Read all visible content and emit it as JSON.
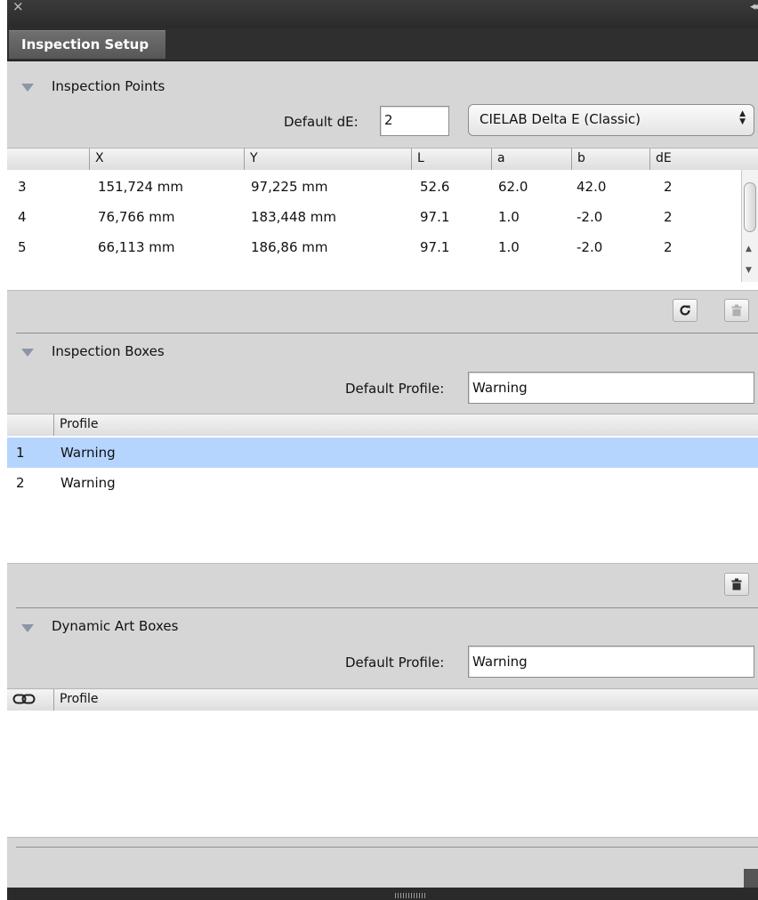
{
  "window": {
    "close_glyph": "×",
    "collapse_glyph": "◂◂",
    "tab_title": "Inspection Setup"
  },
  "points": {
    "title": "Inspection Points",
    "default_de_label": "Default dE:",
    "default_de_value": "2",
    "method_selected": "CIELAB Delta E (Classic)",
    "columns": [
      "",
      "X",
      "Y",
      "L",
      "a",
      "b",
      "dE"
    ],
    "rows": [
      {
        "id": "3",
        "x": "151,724 mm",
        "y": "97,225 mm",
        "L": "52.6",
        "a": "62.0",
        "b": "42.0",
        "dE": "2"
      },
      {
        "id": "4",
        "x": "76,766 mm",
        "y": "183,448 mm",
        "L": "97.1",
        "a": "1.0",
        "b": "-2.0",
        "dE": "2"
      },
      {
        "id": "5",
        "x": "66,113 mm",
        "y": "186,86 mm",
        "L": "97.1",
        "a": "1.0",
        "b": "-2.0",
        "dE": "2"
      }
    ],
    "refresh_icon": "refresh-icon",
    "trash_icon": "trash-icon"
  },
  "boxes": {
    "title": "Inspection Boxes",
    "default_profile_label": "Default Profile:",
    "default_profile_value": "Warning",
    "columns": [
      "",
      "Profile"
    ],
    "rows": [
      {
        "id": "1",
        "profile": "Warning",
        "selected": true
      },
      {
        "id": "2",
        "profile": "Warning",
        "selected": false
      }
    ],
    "selection_color": "#b5d5ff"
  },
  "art_boxes": {
    "title": "Dynamic Art Boxes",
    "default_profile_label": "Default Profile:",
    "default_profile_value": "Warning",
    "link_icon": "link-icon",
    "columns": [
      "Profile"
    ],
    "rows": []
  }
}
